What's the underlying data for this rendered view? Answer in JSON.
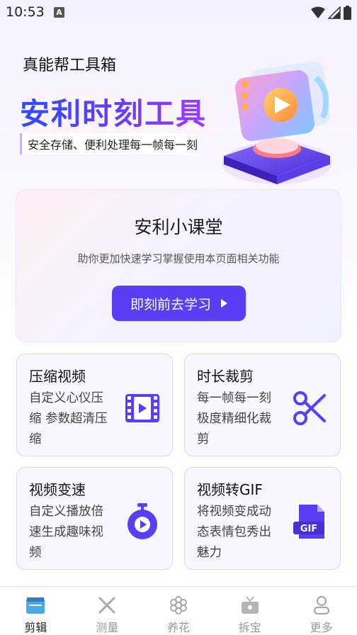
{
  "status_bar": {
    "time": "10:53",
    "notification_glyph": "A"
  },
  "header": {
    "app_name": "真能帮工具箱",
    "hero_title": "安利时刻工具",
    "hero_subtitle": "安全存储、便利处理每一帧每一刻"
  },
  "promo": {
    "title": "安利小课堂",
    "description": "助你更加快速学习掌握使用本页面相关功能",
    "button_label": "即刻前去学习"
  },
  "tools": [
    {
      "title": "压缩视频",
      "description": "自定义心仪压缩 参数超清压缩",
      "icon": "film-icon"
    },
    {
      "title": "时长裁剪",
      "description": "每一帧每一刻极度精细化裁剪",
      "icon": "scissors-icon"
    },
    {
      "title": "视频变速",
      "description": "自定义播放倍速生成趣味视频",
      "icon": "stopwatch-icon"
    },
    {
      "title": "视频转GIF",
      "description": "将视频变成动态表情包秀出魅力",
      "icon": "gif-file-icon"
    }
  ],
  "bottom_nav": [
    {
      "label": "剪辑",
      "active": true
    },
    {
      "label": "测量",
      "active": false
    },
    {
      "label": "养花",
      "active": false
    },
    {
      "label": "拆宝",
      "active": false
    },
    {
      "label": "更多",
      "active": false
    }
  ],
  "colors": {
    "accent": "#5b3df5",
    "card_border": "#ddd5f6",
    "nav_inactive": "#9a9a9a"
  }
}
